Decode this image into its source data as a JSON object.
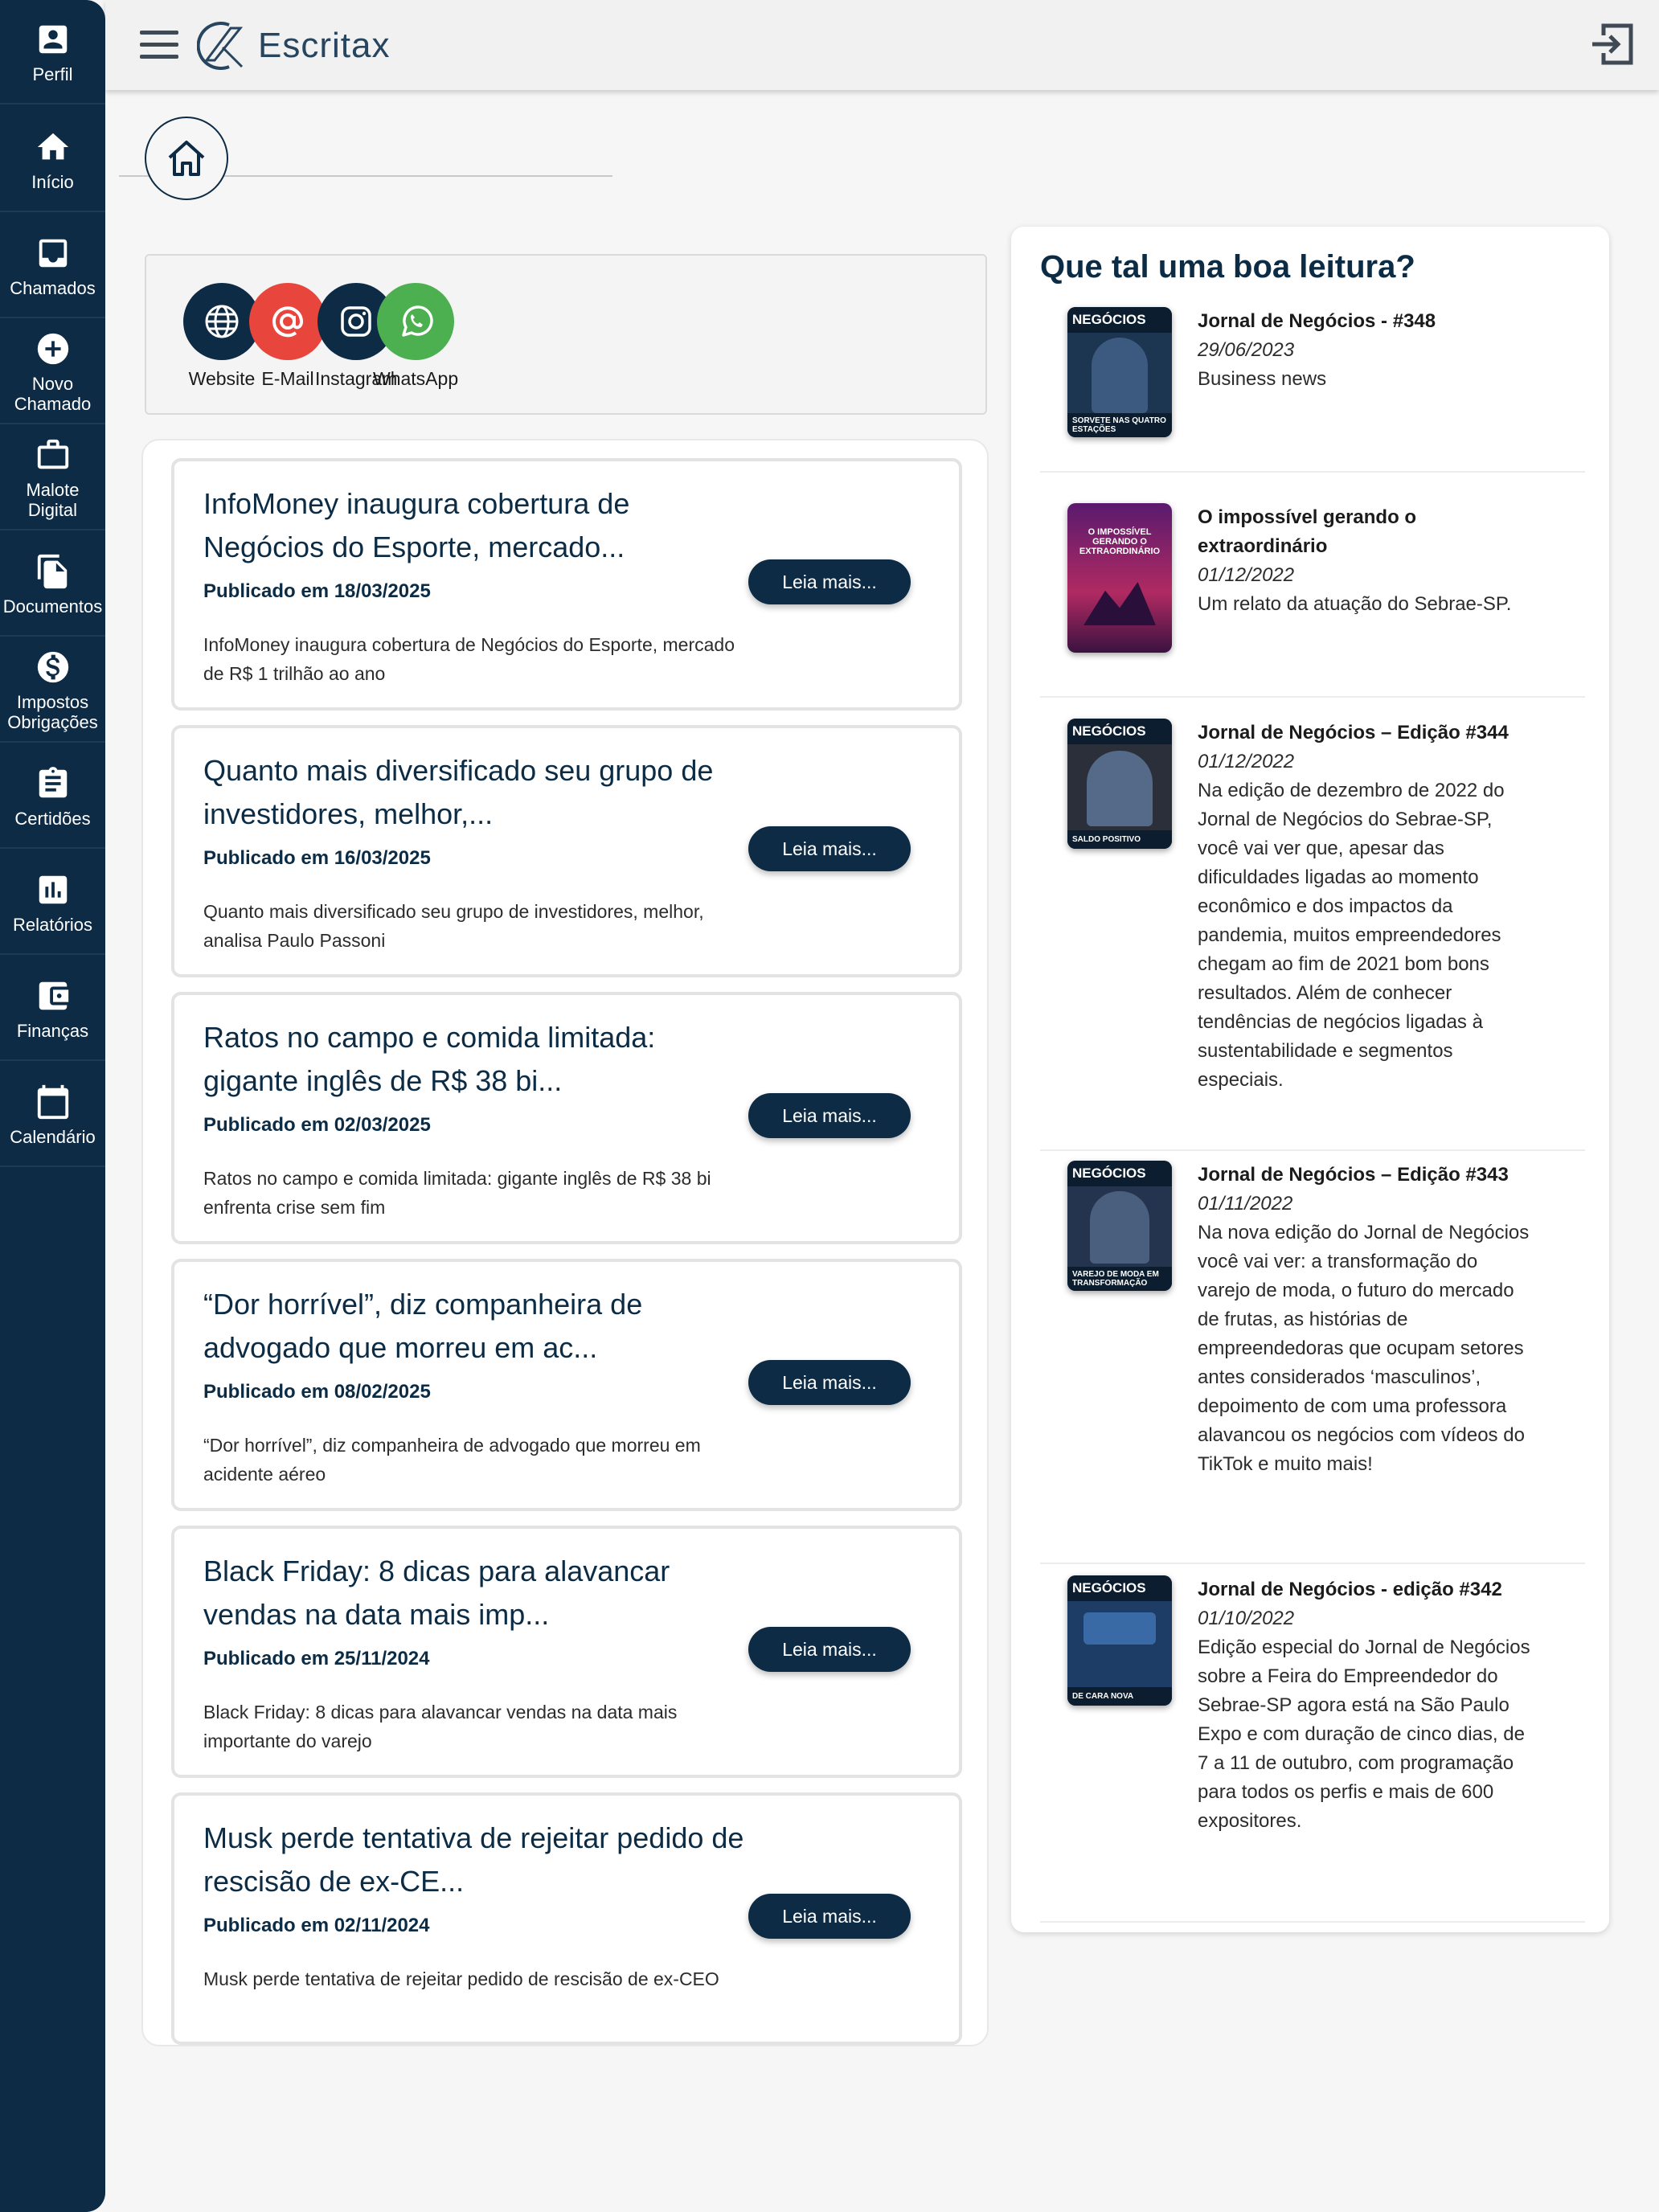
{
  "app": {
    "name": "Escritax"
  },
  "sidebar": {
    "items": [
      {
        "label": "Perfil",
        "icon": "account-box-icon"
      },
      {
        "label": "Início",
        "icon": "home-icon"
      },
      {
        "label": "Chamados",
        "icon": "inbox-icon"
      },
      {
        "label": "Novo Chamado",
        "icon": "add-circle-icon"
      },
      {
        "label": "Malote Digital",
        "icon": "briefcase-icon"
      },
      {
        "label": "Documentos",
        "icon": "file-copy-icon"
      },
      {
        "label": "Impostos Obrigações",
        "icon": "dollar-icon"
      },
      {
        "label": "Certidões",
        "icon": "clipboard-icon"
      },
      {
        "label": "Relatórios",
        "icon": "bar-chart-icon"
      },
      {
        "label": "Finanças",
        "icon": "wallet-icon"
      },
      {
        "label": "Calendário",
        "icon": "calendar-icon"
      }
    ]
  },
  "social": [
    {
      "label": "Website",
      "icon": "globe-icon",
      "color": "#0d2b45"
    },
    {
      "label": "E-Mail",
      "icon": "at-sign-icon",
      "color": "#e8453c"
    },
    {
      "label": "Instagram",
      "icon": "instagram-icon",
      "color": "#0d2b45"
    },
    {
      "label": "WhatsApp",
      "icon": "whatsapp-icon",
      "color": "#4caf50"
    }
  ],
  "news": {
    "button_label": "Leia mais...",
    "items": [
      {
        "title": "InfoMoney inaugura cobertura de Negócios do Esporte, mercado...",
        "date": "Publicado em 18/03/2025",
        "snippet": "InfoMoney inaugura cobertura de Negócios do Esporte, mercado de R$ 1 trilhão ao ano"
      },
      {
        "title": "Quanto mais diversificado seu grupo de investidores, melhor,...",
        "date": "Publicado em 16/03/2025",
        "snippet": "Quanto mais diversificado seu grupo de investidores, melhor, analisa Paulo Passoni"
      },
      {
        "title": "Ratos no campo e comida limitada: gigante inglês de R$ 38 bi...",
        "date": "Publicado em 02/03/2025",
        "snippet": "Ratos no campo e comida limitada: gigante inglês de R$ 38 bi enfrenta crise sem fim"
      },
      {
        "title": "“Dor horrível”, diz companheira de advogado que morreu em ac...",
        "date": "Publicado em 08/02/2025",
        "snippet": "“Dor horrível”, diz companheira de advogado que morreu em acidente aéreo"
      },
      {
        "title": "Black Friday: 8 dicas para alavancar vendas na data mais imp...",
        "date": "Publicado em 25/11/2024",
        "snippet": "Black Friday: 8 dicas para alavancar vendas na data mais importante do varejo"
      },
      {
        "title": "Musk perde tentativa de rejeitar pedido de rescisão de ex-CE...",
        "date": "Publicado em 02/11/2024",
        "snippet": "Musk perde tentativa de rejeitar pedido de rescisão de ex-CEO"
      }
    ]
  },
  "reading": {
    "heading": "Que tal uma boa leitura?",
    "items": [
      {
        "title": "Jornal de Negócios - #348",
        "date": "29/06/2023",
        "desc": "Business news",
        "cover": {
          "masthead": "NEGÓCIOS",
          "caption": "SORVETE NAS QUATRO ESTAÇÕES",
          "bg": "#1c3550"
        }
      },
      {
        "title": "O impossível gerando o extraordinário",
        "date": "01/12/2022",
        "desc": "Um relato da atuação do Sebrae-SP.",
        "cover": {
          "masthead": "O IMPOSSÍVEL GERANDO O EXTRAORDINÁRIO",
          "caption": "",
          "bg": "#8a1f5a"
        }
      },
      {
        "title": "Jornal de Negócios – Edição #344",
        "date": "01/12/2022",
        "desc": "Na edição de dezembro de 2022 do Jornal de Negócios do Sebrae-SP, você vai ver que, apesar das dificuldades ligadas ao momento econômico e dos impactos da pandemia, muitos empreendedores chegam ao fim de 2021 bom bons resultados. Além de conhecer tendências de negócios ligadas à sustentabilidade e segmentos especiais.",
        "cover": {
          "masthead": "NEGÓCIOS",
          "caption": "SALDO POSITIVO",
          "bg": "#2a2f3a"
        }
      },
      {
        "title": "Jornal de Negócios – Edição #343",
        "date": "01/11/2022",
        "desc": "Na nova edição do Jornal de Negócios você vai ver: a transformação do varejo de moda, o futuro do mercado de frutas, as histórias de empreendedoras que ocupam setores antes considerados ‘masculinos’, depoimento de com uma professora alavancou os negócios com vídeos do TikTok e muito mais!",
        "cover": {
          "masthead": "NEGÓCIOS",
          "caption": "VAREJO DE MODA EM TRANSFORMAÇÃO",
          "bg": "#24344f"
        }
      },
      {
        "title": "Jornal de Negócios - edição #342",
        "date": "01/10/2022",
        "desc": "Edição especial do Jornal de Negócios sobre a Feira do Empreendedor do Sebrae-SP agora está na São Paulo Expo e com duração de cinco dias, de 7 a 11 de outubro, com programação para todos os perfis e mais de 600 expositores.",
        "cover": {
          "masthead": "NEGÓCIOS",
          "caption": "DE CARA NOVA",
          "bg": "#1d3c66"
        }
      }
    ]
  }
}
